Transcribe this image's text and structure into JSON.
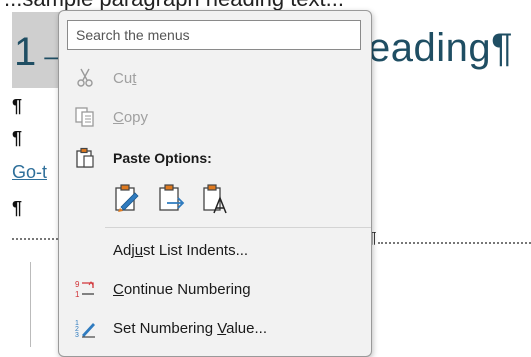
{
  "document": {
    "top_text": "...sample paragraph heading text...",
    "heading_number": "1→",
    "heading_text": "eading¶",
    "pilcrow": "¶",
    "link_text": "Go-t",
    "page_break_mark": "¶"
  },
  "menu": {
    "search_placeholder": "Search the menus",
    "cut": {
      "pre": "Cu",
      "mnemonic": "t",
      "post": ""
    },
    "copy": {
      "pre": "",
      "mnemonic": "C",
      "post": "opy"
    },
    "paste_options": "Paste Options:",
    "adjust": {
      "pre": "Adj",
      "mnemonic": "u",
      "post": "st List Indents..."
    },
    "continue": {
      "pre": "",
      "mnemonic": "C",
      "post": "ontinue Numbering"
    },
    "set_value": {
      "pre": "Set Numbering ",
      "mnemonic": "V",
      "post": "alue..."
    }
  },
  "icons": {
    "cut": "scissors-icon",
    "copy": "copy-icon",
    "paste": "clipboard-icon",
    "keep_formatting": "paste-keep-formatting-icon",
    "merge_formatting": "paste-merge-formatting-icon",
    "keep_text_only": "paste-keep-text-only-icon",
    "continue_numbering": "continue-numbering-icon",
    "set_numbering_value": "set-numbering-value-icon"
  },
  "colors": {
    "heading": "#1f4e63",
    "link": "#2e6f9a",
    "accent_orange": "#e07a1f",
    "accent_blue": "#2f7bbf",
    "accent_red": "#d13438"
  }
}
